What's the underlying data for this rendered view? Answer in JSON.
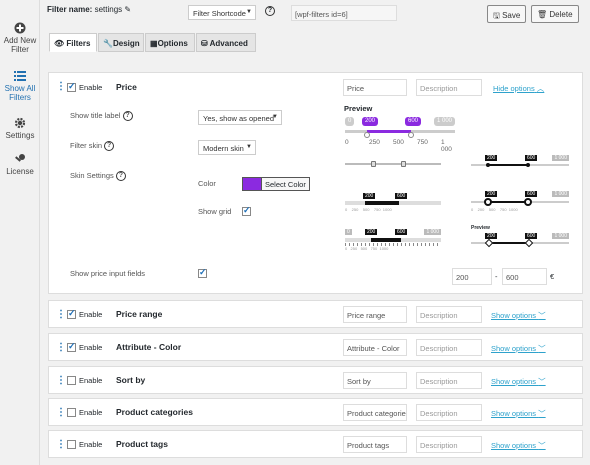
{
  "sidebar": {
    "items": [
      {
        "label": "Add New Filter",
        "icon": "plus-circle-icon"
      },
      {
        "label": "Show All Filters",
        "icon": "list-icon"
      },
      {
        "label": "Settings",
        "icon": "gear-icon"
      },
      {
        "label": "License",
        "icon": "key-icon"
      }
    ]
  },
  "header": {
    "filter_name_label": "Filter name:",
    "filter_name_value": "settings",
    "shortcode_select": "Filter Shortcode",
    "shortcode_text": "[wpf-filters id=6]",
    "save_label": "Save",
    "delete_label": "Delete"
  },
  "tabs": [
    {
      "label": "Filters",
      "icon": "eye-icon"
    },
    {
      "label": "Design",
      "icon": "wrench-icon"
    },
    {
      "label": "Options",
      "icon": "grid-icon"
    },
    {
      "label": "Advanced",
      "icon": "database-icon"
    }
  ],
  "price_filter": {
    "enable_label": "Enable",
    "title": "Price",
    "name_input": "Price",
    "description_placeholder": "Description",
    "hide_options": "Hide options",
    "show_title_label": "Show title label",
    "show_title_value": "Yes, show as opened",
    "filter_skin_label": "Filter skin",
    "filter_skin_value": "Modern skin",
    "skin_settings_label": "Skin Settings",
    "color_label": "Color",
    "color_value": "#8b2ae0",
    "select_color": "Select Color",
    "show_grid_label": "Show grid",
    "show_price_inputs_label": "Show price input fields",
    "preview_label": "Preview",
    "preview_min_tag": "0",
    "preview_low": "200",
    "preview_high": "600",
    "preview_max_tag": "1 000",
    "preview_low_fraction": 0.2,
    "preview_high_fraction": 0.6,
    "preview_ticks": [
      "0",
      "250",
      "500",
      "750",
      "1 000"
    ],
    "price_min": "200",
    "price_max": "600",
    "range_sep": "-",
    "currency": "€"
  },
  "filters": [
    {
      "enabled": true,
      "title": "Price range",
      "name": "Price range",
      "description": "Description",
      "show_options": "Show options"
    },
    {
      "enabled": true,
      "title": "Attribute - Color",
      "name": "Attribute - Color",
      "description": "Description",
      "show_options": "Show options"
    },
    {
      "enabled": false,
      "title": "Sort by",
      "name": "Sort by",
      "description": "Description",
      "show_options": "Show options"
    },
    {
      "enabled": false,
      "title": "Product categories",
      "name": "Product categorie",
      "description": "Description",
      "show_options": "Show options"
    },
    {
      "enabled": false,
      "title": "Product tags",
      "name": "Product tags",
      "description": "Description",
      "show_options": "Show options"
    }
  ],
  "colors": {
    "accent": "#2ea2cc",
    "brand_purple": "#8b2ae0"
  }
}
